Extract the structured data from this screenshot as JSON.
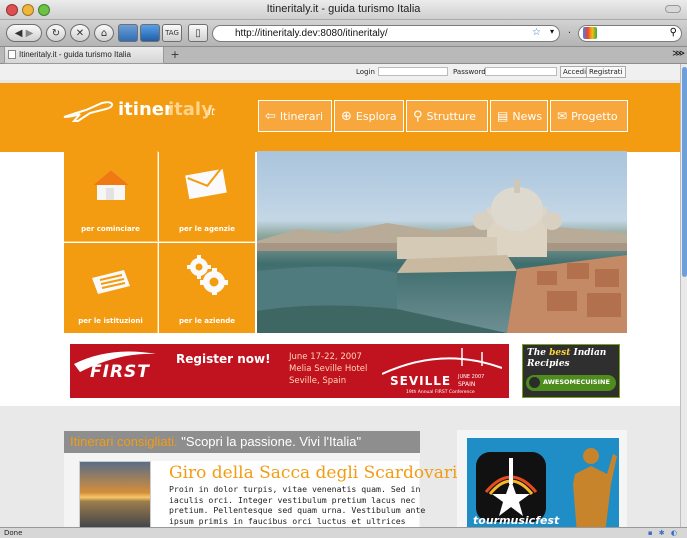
{
  "browser": {
    "window_title": "Itineritaly.it - guida turismo Italia",
    "url": "http://itineritaly.dev:8080/itineritaly/",
    "tab_label": "Itineritaly.it - guida turismo Italia",
    "new_tab": "+",
    "status": "Done"
  },
  "login": {
    "login_label": "Login",
    "password_label": "Password",
    "access_button": "Accedi",
    "register_button": "Registrati"
  },
  "site": {
    "logo_main": "itiner",
    "logo_accent": "italy",
    "logo_tld": ".it",
    "nav": [
      "Itinerari",
      "Esplora",
      "Strutture",
      "News",
      "Progetto"
    ]
  },
  "tiles": [
    "per cominciare",
    "per le agenzie",
    "per le istituzioni",
    "per le aziende"
  ],
  "banner": {
    "brand": "FIRST",
    "cta": "Register now!",
    "date": "June 17-22, 2007",
    "venue": "Melia Seville Hotel",
    "city": "Seville, Spain",
    "city_big": "SEVILLE",
    "year_tag": "JUNE 2007",
    "country": "SPAIN",
    "conf": "19th Annual FIRST Conference"
  },
  "recipes": {
    "line1_a": "The ",
    "line1_b": "best",
    "line1_c": " Indian",
    "line2": "Recipies",
    "logo": "AWESOMECUISINE"
  },
  "featured": {
    "section_label": "Itinerari consigliati.",
    "tagline": "\"Scopri la passione. Vivi l'Italia\"",
    "article_title": "Giro della Sacca degli Scardovari",
    "article_text": "Proin in dolor turpis, vitae venenatis quam. Sed in iaculis orci. Integer vestibulum pretium lacus nec pretium. Pellentesque sed quam urna. Vestibulum ante ipsum primis in faucibus orci luctus et ultrices posuere cubilia Curae; Maecenas cursus rhoncus ante in"
  },
  "ad": {
    "brand": "tourmusicfest"
  },
  "colors": {
    "accent": "#f39c12",
    "banner_red": "#c1121f"
  }
}
